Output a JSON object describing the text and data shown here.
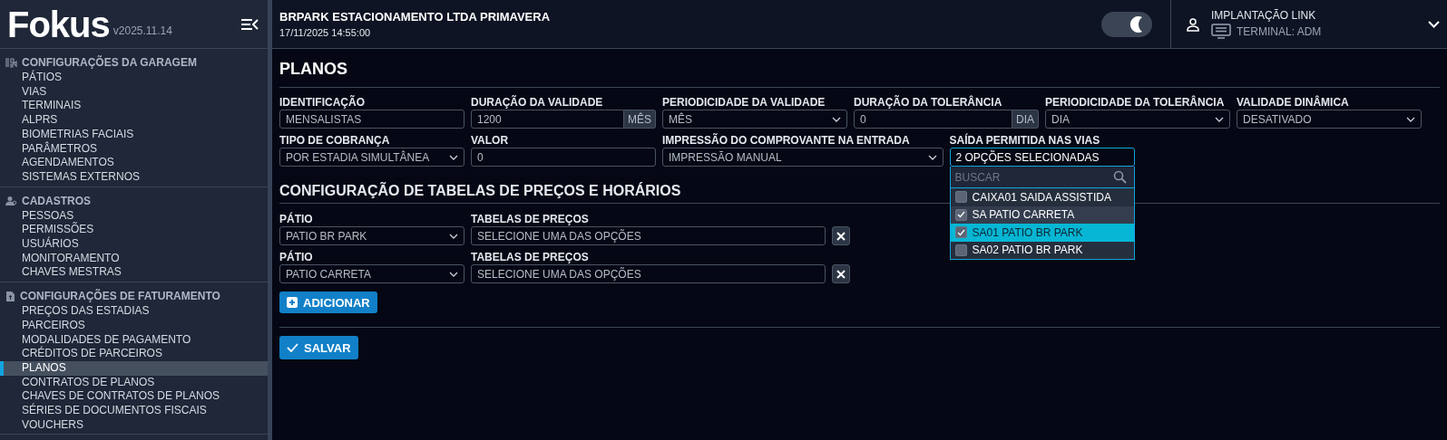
{
  "logo": "Fokus",
  "version": "v2025.11.14",
  "sidebar": {
    "sections": [
      {
        "title": "CONFIGURAÇÕES DA GARAGEM",
        "items": [
          {
            "label": "PÁTIOS",
            "selected": false
          },
          {
            "label": "VIAS",
            "selected": false
          },
          {
            "label": "TERMINAIS",
            "selected": false
          },
          {
            "label": "ALPRS",
            "selected": false
          },
          {
            "label": "BIOMETRIAS FACIAIS",
            "selected": false
          },
          {
            "label": "PARÂMETROS",
            "selected": false
          },
          {
            "label": "AGENDAMENTOS",
            "selected": false
          },
          {
            "label": "SISTEMAS EXTERNOS",
            "selected": false
          }
        ]
      },
      {
        "title": "CADASTROS",
        "items": [
          {
            "label": "PESSOAS",
            "selected": false
          },
          {
            "label": "PERMISSÕES",
            "selected": false
          },
          {
            "label": "USUÁRIOS",
            "selected": false
          },
          {
            "label": "MONITORAMENTO",
            "selected": false
          },
          {
            "label": "CHAVES MESTRAS",
            "selected": false
          }
        ]
      },
      {
        "title": "CONFIGURAÇÕES DE FATURAMENTO",
        "items": [
          {
            "label": "PREÇOS DAS ESTADIAS",
            "selected": false
          },
          {
            "label": "PARCEIROS",
            "selected": false
          },
          {
            "label": "MODALIDADES DE PAGAMENTO",
            "selected": false
          },
          {
            "label": "CRÉDITOS DE PARCEIROS",
            "selected": false
          },
          {
            "label": "PLANOS",
            "selected": true
          },
          {
            "label": "CONTRATOS DE PLANOS",
            "selected": false
          },
          {
            "label": "CHAVES DE CONTRATOS DE PLANOS",
            "selected": false
          },
          {
            "label": "SÉRIES DE DOCUMENTOS FISCAIS",
            "selected": false
          },
          {
            "label": "VOUCHERS",
            "selected": false
          }
        ]
      }
    ]
  },
  "header": {
    "company": "BRPARK ESTACIONAMENTO LTDA PRIMAVERA",
    "datetime": "17/11/2025 14:55:00",
    "dark_mode": true,
    "user": "IMPLANTAÇÃO LINK",
    "terminal": "TERMINAL: ADM"
  },
  "page_title": "PLANOS",
  "fields": [
    {
      "kind": "text",
      "label": "IDENTIFICAÇÃO",
      "value": "MENSALISTAS"
    },
    {
      "kind": "addon",
      "label": "DURAÇÃO DA VALIDADE",
      "value": "1200",
      "addon": "MÊS"
    },
    {
      "kind": "select",
      "label": "PERIODICIDADE DA VALIDADE",
      "value": "MÊS"
    },
    {
      "kind": "addon",
      "label": "DURAÇÃO DA TOLERÂNCIA",
      "value": "0",
      "addon": "DIA"
    },
    {
      "kind": "select",
      "label": "PERIODICIDADE DA TOLERÂNCIA",
      "value": "DIA"
    },
    {
      "kind": "select",
      "label": "VALIDADE DINÂMICA",
      "value": "DESATIVADO"
    },
    {
      "kind": "select",
      "label": "TIPO DE COBRANÇA",
      "value": "POR ESTADIA SIMULTÂNEA"
    },
    {
      "kind": "text",
      "label": "VALOR",
      "value": "0"
    },
    {
      "kind": "select",
      "label": "IMPRESSÃO DO COMPROVANTE NA ENTRADA",
      "value": "IMPRESSÃO MANUAL"
    },
    {
      "kind": "multiselect",
      "label": "SAÍDA PERMITIDA NAS VIAS",
      "value": "2 OPÇÕES SELECIONADAS",
      "expanded": true,
      "search_placeholder": "BUSCAR",
      "options": [
        {
          "label": "CAIXA01 SAIDA ASSISTIDA",
          "checked": false,
          "selected": false
        },
        {
          "label": "SA PATIO CARRETA",
          "checked": true,
          "selected": false
        },
        {
          "label": "SA01 PATIO BR PARK",
          "checked": true,
          "selected": true
        },
        {
          "label": "SA02 PATIO BR PARK",
          "checked": false,
          "selected": false
        }
      ]
    }
  ],
  "section_title": "CONFIGURAÇÃO DE TABELAS DE PREÇOS E HORÁRIOS",
  "price_rows": [
    {
      "patio_label": "PÁTIO",
      "patio": "PATIO BR PARK",
      "tables_label": "TABELAS DE PREÇOS",
      "tables_placeholder": "SELECIONE UMA DAS OPÇÕES"
    },
    {
      "patio_label": "PÁTIO",
      "patio": "PATIO CARRETA",
      "tables_label": "TABELAS DE PREÇOS",
      "tables_placeholder": "SELECIONE UMA DAS OPÇÕES"
    }
  ],
  "add_button": "ADICIONAR",
  "save_button": "SALVAR"
}
